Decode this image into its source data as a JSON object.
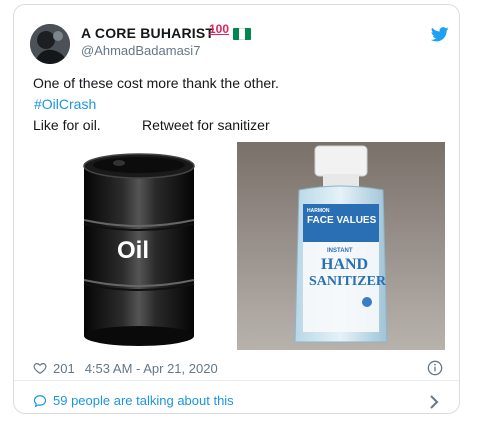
{
  "tweet": {
    "author": {
      "display_name": "A CORE BUHARIST",
      "badge": "100",
      "handle": "@AhmadBadamasi7"
    },
    "lines": [
      "One of these cost more thank the other.",
      "#OilCrash",
      "Like for oil.",
      "Retweet for sanitizer"
    ],
    "images": {
      "oil_label": "Oil",
      "sanitizer": {
        "brand_small": "HARMON",
        "brand": "FACE VALUES",
        "instant": "INSTANT",
        "line1": "HAND",
        "line2": "SANITIZER"
      }
    },
    "likes": "201",
    "timestamp": "4:53 AM - Apr 21, 2020",
    "talking": "59 people are talking about this"
  },
  "colors": {
    "link": "#1b95e0",
    "muted": "#657786",
    "badge": "#e0245e",
    "flag_green": "#008751"
  },
  "icons": [
    "twitter-bird-icon",
    "heart-icon",
    "info-icon",
    "comment-bubble-icon",
    "chevron-right-icon",
    "nigeria-flag-icon"
  ]
}
